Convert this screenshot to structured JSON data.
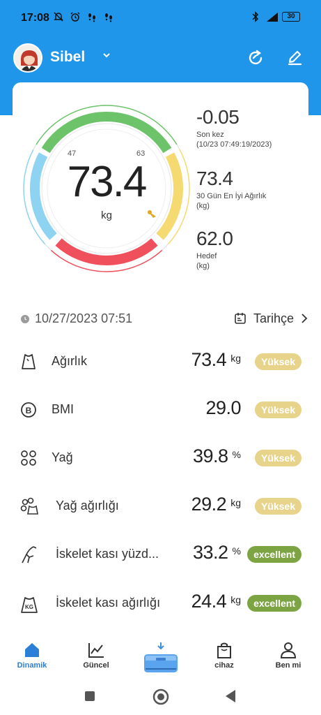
{
  "status": {
    "time": "17:08",
    "battery": "30"
  },
  "user": {
    "name": "Sibel"
  },
  "gauge": {
    "value": "73.4",
    "unit": "kg",
    "tick_low": "47",
    "tick_high": "63"
  },
  "stats": [
    {
      "value": "-0.05",
      "label1": "Son kez",
      "label2": "(10/23 07:49:19/2023)"
    },
    {
      "value": "73.4",
      "label1": "30 Gün En İyi Ağırlık",
      "label2": "(kg)"
    },
    {
      "value": "62.0",
      "label1": "Hedef",
      "label2": "(kg)"
    }
  ],
  "measurement": {
    "datetime": "10/27/2023 07:51",
    "history_label": "Tarihçe"
  },
  "metrics": [
    {
      "label": "Ağırlık",
      "value": "73.4",
      "unit": "kg",
      "status": "Yüksek",
      "status_color": "#e8d38b",
      "icon": "weight-icon"
    },
    {
      "label": "BMI",
      "value": "29.0",
      "unit": "",
      "status": "Yüksek",
      "status_color": "#e8d38b",
      "icon": "bmi-icon"
    },
    {
      "label": "Yağ",
      "value": "39.8",
      "unit": "%",
      "status": "Yüksek",
      "status_color": "#e8d38b",
      "icon": "fat-icon"
    },
    {
      "label": "Yağ ağırlığı",
      "value": "29.2",
      "unit": "kg",
      "status": "Yüksek",
      "status_color": "#e8d38b",
      "icon": "fat-weight-icon"
    },
    {
      "label": "İskelet kası yüzd...",
      "value": "33.2",
      "unit": "%",
      "status": "excellent",
      "status_color": "#7da443",
      "icon": "skeletal-muscle-icon"
    },
    {
      "label": "İskelet kası ağırlığı",
      "value": "24.4",
      "unit": "kg",
      "status": "excellent",
      "status_color": "#7da443",
      "icon": "skeletal-muscle-weight-icon"
    }
  ],
  "nav": [
    {
      "label": "Dinamik",
      "icon": "home-icon",
      "active": true
    },
    {
      "label": "Güncel",
      "icon": "chart-icon",
      "active": false
    },
    {
      "label": "",
      "icon": "scale-icon",
      "active": false
    },
    {
      "label": "cihaz",
      "icon": "bag-icon",
      "active": false
    },
    {
      "label": "Ben mi",
      "icon": "person-icon",
      "active": false
    }
  ],
  "colors": {
    "primary": "#1f96ea",
    "gauge_green": "#6cc36a",
    "gauge_yellow": "#f5da72",
    "gauge_red": "#f0505c",
    "gauge_blue": "#8fd3f2"
  }
}
